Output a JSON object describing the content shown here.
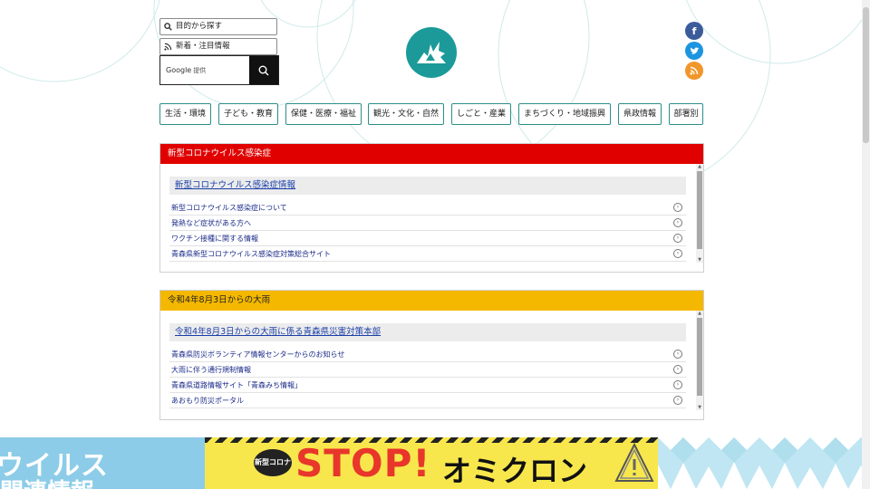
{
  "header": {
    "side_links": [
      {
        "label": "目的から探す",
        "icon": "search-icon"
      },
      {
        "label": "新着・注目情報",
        "icon": "rss-icon"
      }
    ],
    "search": {
      "brand_label": "Google",
      "sub_label": "提供",
      "button_icon": "search-icon"
    },
    "logo_icon": "aomori-prefecture-logo",
    "social": [
      {
        "name": "facebook",
        "glyph": "f"
      },
      {
        "name": "twitter",
        "glyph": "t"
      },
      {
        "name": "rss",
        "glyph": "r"
      }
    ]
  },
  "nav": {
    "items": [
      "生活・環境",
      "子ども・教育",
      "保健・医療・福祉",
      "観光・文化・自然",
      "しごと・産業",
      "まちづくり・地域振興",
      "県政情報",
      "部署別"
    ]
  },
  "panels": {
    "covid": {
      "title": "新型コロナウイルス感染症",
      "sub_title": "新型コロナウイルス感染症情報",
      "links": [
        "新型コロナウイルス感染症について",
        "発熱など症状がある方へ",
        "ワクチン接種に関する情報",
        "青森県新型コロナウイルス感染症対策総合サイト"
      ],
      "color": "#e00000"
    },
    "rain": {
      "title": "令和4年8月3日からの大雨",
      "sub_title": "令和4年8月3日からの大雨に係る青森県災害対策本部",
      "links": [
        "青森県防災ボランティア情報センターからのお知らせ",
        "大雨に伴う通行規制情報",
        "青森県道路情報サイト「青森みち情報」",
        "あおもり防災ポータル"
      ],
      "color": "#f5b800"
    }
  },
  "banners": {
    "left": {
      "line1": "ウイルス",
      "line2": "関連情報"
    },
    "middle": {
      "badge": "新型コロナ",
      "stop": "STOP!",
      "text": "オミクロン"
    }
  }
}
